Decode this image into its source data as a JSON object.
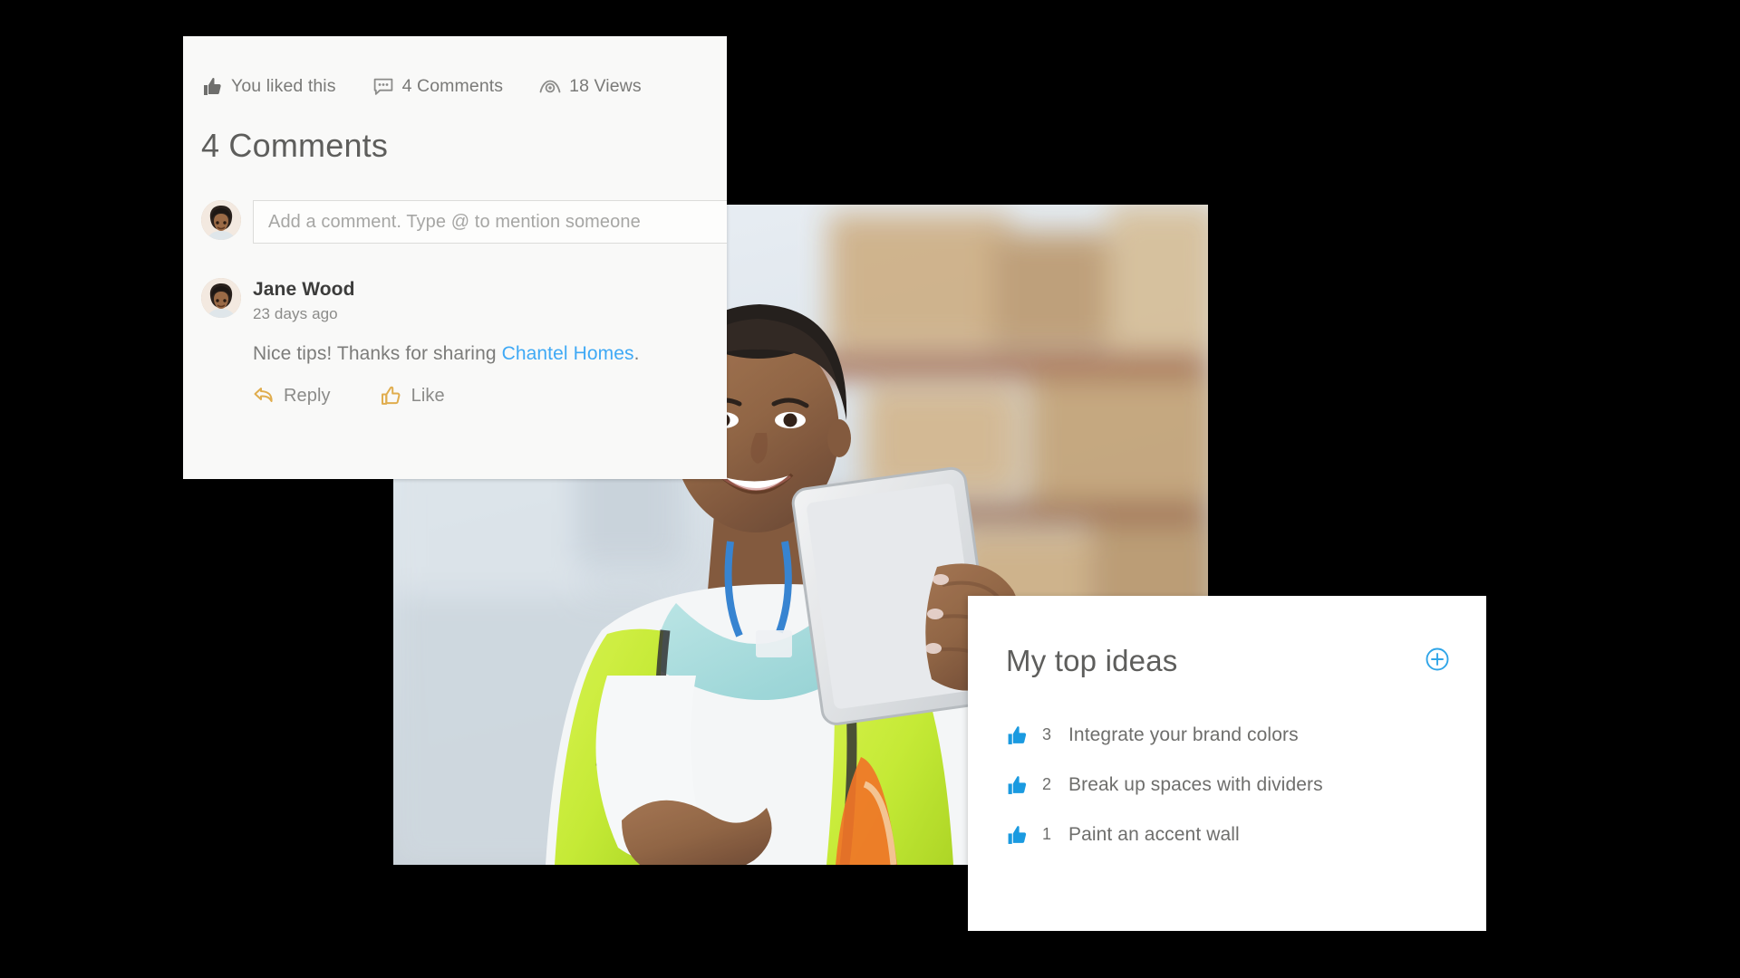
{
  "post_stats": {
    "like_status": {
      "icon": "thumbs-up-icon",
      "label": "You liked this"
    },
    "comments": {
      "icon": "comment-bubble-icon",
      "label": "4 Comments"
    },
    "views": {
      "icon": "eye-icon",
      "label": "18 Views"
    }
  },
  "comments_section": {
    "heading": "4 Comments",
    "input": {
      "placeholder": "Add a comment. Type @ to mention someone",
      "value": "",
      "avatar": "user-avatar"
    },
    "items": [
      {
        "author": "Jane Wood",
        "timestamp": "23 days ago",
        "text_before": "Nice tips! Thanks for sharing ",
        "mention": "Chantel Homes",
        "text_after": ".",
        "actions": {
          "reply": {
            "icon": "reply-arrow-icon",
            "label": "Reply"
          },
          "like": {
            "icon": "thumbs-up-outline-icon",
            "label": "Like"
          }
        }
      }
    ]
  },
  "ideas_card": {
    "title": "My top ideas",
    "add_button": {
      "icon": "plus-circle-icon",
      "label": ""
    },
    "items": [
      {
        "icon": "thumbs-up-icon",
        "count": "3",
        "label": "Integrate your brand colors"
      },
      {
        "icon": "thumbs-up-icon",
        "count": "2",
        "label": "Break up spaces with dividers"
      },
      {
        "icon": "thumbs-up-icon",
        "count": "1",
        "label": "Paint an accent wall"
      }
    ]
  },
  "photo": {
    "alt": "Smiling warehouse worker in high-visibility vest holding a tablet"
  },
  "colors": {
    "accent_blue": "#1a9ae0",
    "link_blue": "#3fa9f5",
    "action_gold": "#e8b552",
    "text_gray": "#7c7c7a",
    "card_bg": "#f9f9f8"
  }
}
